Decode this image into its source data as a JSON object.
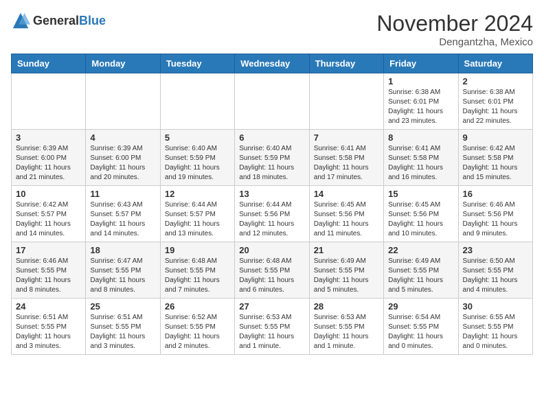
{
  "header": {
    "logo_general": "General",
    "logo_blue": "Blue",
    "month_title": "November 2024",
    "location": "Dengantzha, Mexico"
  },
  "weekdays": [
    "Sunday",
    "Monday",
    "Tuesday",
    "Wednesday",
    "Thursday",
    "Friday",
    "Saturday"
  ],
  "weeks": [
    [
      {
        "day": "",
        "info": ""
      },
      {
        "day": "",
        "info": ""
      },
      {
        "day": "",
        "info": ""
      },
      {
        "day": "",
        "info": ""
      },
      {
        "day": "",
        "info": ""
      },
      {
        "day": "1",
        "info": "Sunrise: 6:38 AM\nSunset: 6:01 PM\nDaylight: 11 hours and 23 minutes."
      },
      {
        "day": "2",
        "info": "Sunrise: 6:38 AM\nSunset: 6:01 PM\nDaylight: 11 hours and 22 minutes."
      }
    ],
    [
      {
        "day": "3",
        "info": "Sunrise: 6:39 AM\nSunset: 6:00 PM\nDaylight: 11 hours and 21 minutes."
      },
      {
        "day": "4",
        "info": "Sunrise: 6:39 AM\nSunset: 6:00 PM\nDaylight: 11 hours and 20 minutes."
      },
      {
        "day": "5",
        "info": "Sunrise: 6:40 AM\nSunset: 5:59 PM\nDaylight: 11 hours and 19 minutes."
      },
      {
        "day": "6",
        "info": "Sunrise: 6:40 AM\nSunset: 5:59 PM\nDaylight: 11 hours and 18 minutes."
      },
      {
        "day": "7",
        "info": "Sunrise: 6:41 AM\nSunset: 5:58 PM\nDaylight: 11 hours and 17 minutes."
      },
      {
        "day": "8",
        "info": "Sunrise: 6:41 AM\nSunset: 5:58 PM\nDaylight: 11 hours and 16 minutes."
      },
      {
        "day": "9",
        "info": "Sunrise: 6:42 AM\nSunset: 5:58 PM\nDaylight: 11 hours and 15 minutes."
      }
    ],
    [
      {
        "day": "10",
        "info": "Sunrise: 6:42 AM\nSunset: 5:57 PM\nDaylight: 11 hours and 14 minutes."
      },
      {
        "day": "11",
        "info": "Sunrise: 6:43 AM\nSunset: 5:57 PM\nDaylight: 11 hours and 14 minutes."
      },
      {
        "day": "12",
        "info": "Sunrise: 6:44 AM\nSunset: 5:57 PM\nDaylight: 11 hours and 13 minutes."
      },
      {
        "day": "13",
        "info": "Sunrise: 6:44 AM\nSunset: 5:56 PM\nDaylight: 11 hours and 12 minutes."
      },
      {
        "day": "14",
        "info": "Sunrise: 6:45 AM\nSunset: 5:56 PM\nDaylight: 11 hours and 11 minutes."
      },
      {
        "day": "15",
        "info": "Sunrise: 6:45 AM\nSunset: 5:56 PM\nDaylight: 11 hours and 10 minutes."
      },
      {
        "day": "16",
        "info": "Sunrise: 6:46 AM\nSunset: 5:56 PM\nDaylight: 11 hours and 9 minutes."
      }
    ],
    [
      {
        "day": "17",
        "info": "Sunrise: 6:46 AM\nSunset: 5:55 PM\nDaylight: 11 hours and 8 minutes."
      },
      {
        "day": "18",
        "info": "Sunrise: 6:47 AM\nSunset: 5:55 PM\nDaylight: 11 hours and 8 minutes."
      },
      {
        "day": "19",
        "info": "Sunrise: 6:48 AM\nSunset: 5:55 PM\nDaylight: 11 hours and 7 minutes."
      },
      {
        "day": "20",
        "info": "Sunrise: 6:48 AM\nSunset: 5:55 PM\nDaylight: 11 hours and 6 minutes."
      },
      {
        "day": "21",
        "info": "Sunrise: 6:49 AM\nSunset: 5:55 PM\nDaylight: 11 hours and 5 minutes."
      },
      {
        "day": "22",
        "info": "Sunrise: 6:49 AM\nSunset: 5:55 PM\nDaylight: 11 hours and 5 minutes."
      },
      {
        "day": "23",
        "info": "Sunrise: 6:50 AM\nSunset: 5:55 PM\nDaylight: 11 hours and 4 minutes."
      }
    ],
    [
      {
        "day": "24",
        "info": "Sunrise: 6:51 AM\nSunset: 5:55 PM\nDaylight: 11 hours and 3 minutes."
      },
      {
        "day": "25",
        "info": "Sunrise: 6:51 AM\nSunset: 5:55 PM\nDaylight: 11 hours and 3 minutes."
      },
      {
        "day": "26",
        "info": "Sunrise: 6:52 AM\nSunset: 5:55 PM\nDaylight: 11 hours and 2 minutes."
      },
      {
        "day": "27",
        "info": "Sunrise: 6:53 AM\nSunset: 5:55 PM\nDaylight: 11 hours and 1 minute."
      },
      {
        "day": "28",
        "info": "Sunrise: 6:53 AM\nSunset: 5:55 PM\nDaylight: 11 hours and 1 minute."
      },
      {
        "day": "29",
        "info": "Sunrise: 6:54 AM\nSunset: 5:55 PM\nDaylight: 11 hours and 0 minutes."
      },
      {
        "day": "30",
        "info": "Sunrise: 6:55 AM\nSunset: 5:55 PM\nDaylight: 11 hours and 0 minutes."
      }
    ]
  ]
}
